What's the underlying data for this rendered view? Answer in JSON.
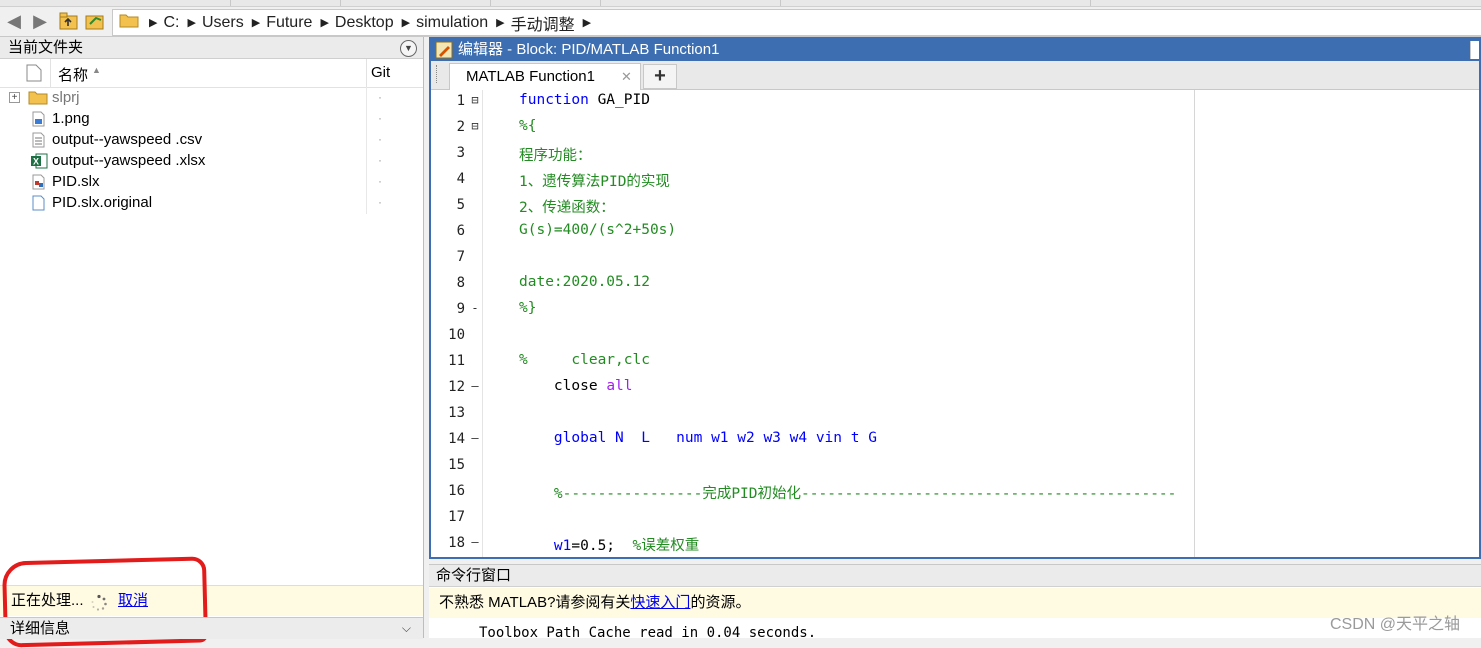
{
  "address": {
    "segments": [
      "C:",
      "Users",
      "Future",
      "Desktop",
      "simulation",
      "手动调整"
    ]
  },
  "left_panel": {
    "title": "当前文件夹",
    "columns": {
      "name": "名称",
      "git": "Git"
    },
    "files": [
      {
        "name": "slprj",
        "type": "folder",
        "git": "·"
      },
      {
        "name": "1.png",
        "type": "png",
        "git": "·"
      },
      {
        "name": "output--yawspeed .csv",
        "type": "csv",
        "git": "·"
      },
      {
        "name": "output--yawspeed .xlsx",
        "type": "xlsx",
        "git": "·"
      },
      {
        "name": "PID.slx",
        "type": "slx",
        "git": "·"
      },
      {
        "name": "PID.slx.original",
        "type": "file",
        "git": "·"
      }
    ],
    "status": {
      "text": "正在处理...",
      "cancel": "取消"
    },
    "details_label": "详细信息"
  },
  "editor": {
    "title": "编辑器 - Block: PID/MATLAB Function1",
    "tab_label": "MATLAB Function1",
    "tab_close": "✕",
    "add_tab": "+",
    "lines": [
      {
        "n": "1",
        "gutter": "⊟",
        "segs": [
          {
            "t": "function",
            "c": "kw"
          },
          {
            "t": " GA_PID",
            "c": ""
          }
        ]
      },
      {
        "n": "2",
        "gutter": "⊟",
        "segs": [
          {
            "t": "%{",
            "c": "cm"
          }
        ]
      },
      {
        "n": "3",
        "gutter": "",
        "segs": [
          {
            "t": "程序功能：",
            "c": "cm"
          }
        ]
      },
      {
        "n": "4",
        "gutter": "",
        "segs": [
          {
            "t": "1、遗传算法PID的实现",
            "c": "cm"
          }
        ]
      },
      {
        "n": "5",
        "gutter": "",
        "segs": [
          {
            "t": "2、传递函数：",
            "c": "cm"
          }
        ]
      },
      {
        "n": "6",
        "gutter": "",
        "segs": [
          {
            "t": "G(s)=400/(s^2+50s)",
            "c": "cm"
          }
        ]
      },
      {
        "n": "7",
        "gutter": "",
        "segs": []
      },
      {
        "n": "8",
        "gutter": "",
        "segs": [
          {
            "t": "date:2020.05.12",
            "c": "cm"
          }
        ]
      },
      {
        "n": "9",
        "gutter": "-",
        "segs": [
          {
            "t": "%}",
            "c": "cm"
          }
        ]
      },
      {
        "n": "10",
        "gutter": "",
        "segs": []
      },
      {
        "n": "11",
        "gutter": "",
        "segs": [
          {
            "t": "%     clear,clc",
            "c": "cm"
          }
        ]
      },
      {
        "n": "12",
        "gutter": "—",
        "segs": [
          {
            "t": "    close ",
            "c": ""
          },
          {
            "t": "all",
            "c": "str"
          }
        ]
      },
      {
        "n": "13",
        "gutter": "",
        "segs": []
      },
      {
        "n": "14",
        "gutter": "—",
        "segs": [
          {
            "t": "    global",
            "c": "kw"
          },
          {
            "t": " N  L   num w1 w2 w3 w4 vin t G",
            "c": "kw"
          }
        ]
      },
      {
        "n": "15",
        "gutter": "",
        "segs": []
      },
      {
        "n": "16",
        "gutter": "",
        "segs": [
          {
            "t": "    %----------------完成PID初始化-------------------------------------------",
            "c": "cm"
          }
        ]
      },
      {
        "n": "17",
        "gutter": "",
        "segs": []
      },
      {
        "n": "18",
        "gutter": "—",
        "segs": [
          {
            "t": "    w1",
            "c": "kw"
          },
          {
            "t": "=0.5;  ",
            "c": ""
          },
          {
            "t": "%误差权重",
            "c": "cm"
          }
        ]
      }
    ]
  },
  "command_window": {
    "title": "命令行窗口",
    "info_prefix": "不熟悉 MATLAB?请参阅有关",
    "info_link": "快速入门",
    "info_suffix": "的资源。",
    "output": "Toolbox Path Cache read in 0.04 seconds."
  },
  "watermark": "CSDN @天平之轴"
}
